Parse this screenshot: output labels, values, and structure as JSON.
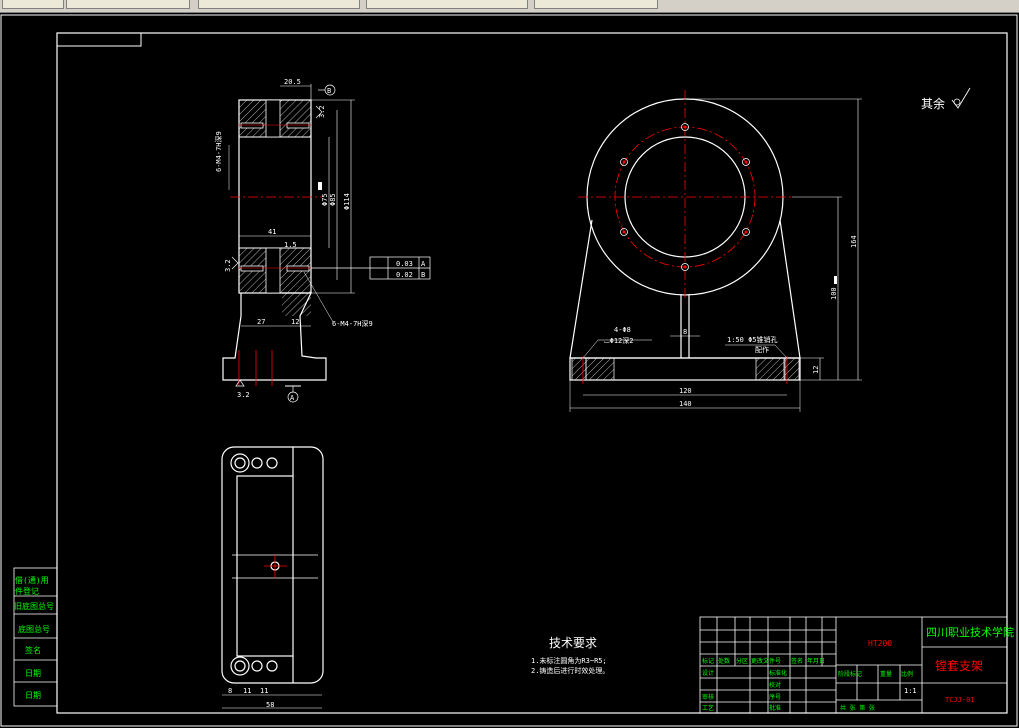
{
  "toolbar": {
    "tabs": [
      "",
      "",
      "",
      "",
      ""
    ]
  },
  "drawing": {
    "dimensions": {
      "d20_5": "20.5",
      "d41": "41",
      "d1_5": "1.5",
      "d27": "27",
      "d12": "12",
      "d3_2a": "3.2",
      "d3_2b": "3.2",
      "d3_2c": "3.2",
      "phi114": "Φ114",
      "phi85": "Φ85",
      "phi75": "Φ75",
      "hole_left": "6-M4-7H深9",
      "hole_bottom": "6-M4-7H深9",
      "tol1": "0.03",
      "tol2": "0.02",
      "datum_a": "A",
      "datum_b": "B",
      "d164": "164",
      "d100": "100",
      "d8": "8",
      "d12b": "12",
      "d120": "120",
      "d140": "140",
      "holes_note1": "4-Φ8",
      "holes_note2": "⌴Φ12深2",
      "cone_note1": "1:50 Φ5锥销孔",
      "cone_note2": "配作",
      "b8": "8",
      "b11": "11",
      "b11b": "11",
      "b58": "58",
      "roughness_note": "其余"
    },
    "tech_requirements": {
      "title": "技术要求",
      "line1": "1.未标注圆角为R3~R5;",
      "line2": "2.铸造后进行时效处理。"
    },
    "title_block": {
      "material": "HT200",
      "school": "四川职业技术学院",
      "part_name": "镗套支架",
      "drawing_no": "TCJJ-01",
      "scale": "1:1",
      "labels": {
        "design": "设计",
        "standard": "标准化",
        "process": "工艺",
        "review": "审核",
        "approve": "批准",
        "check": "校对",
        "stage": "阶段标记",
        "weight": "重量",
        "ratio": "比例",
        "sheets": "共  张  第  张",
        "mark": "标记",
        "count": "处数",
        "zone": "分区",
        "change_doc": "更改文件号",
        "sign": "签名",
        "date": "年月日",
        "seq": "序号"
      }
    },
    "side_labels": [
      "借(通)用",
      "件登记",
      "旧底图总号",
      "底图总号",
      "签名",
      "日期",
      "日期"
    ]
  }
}
